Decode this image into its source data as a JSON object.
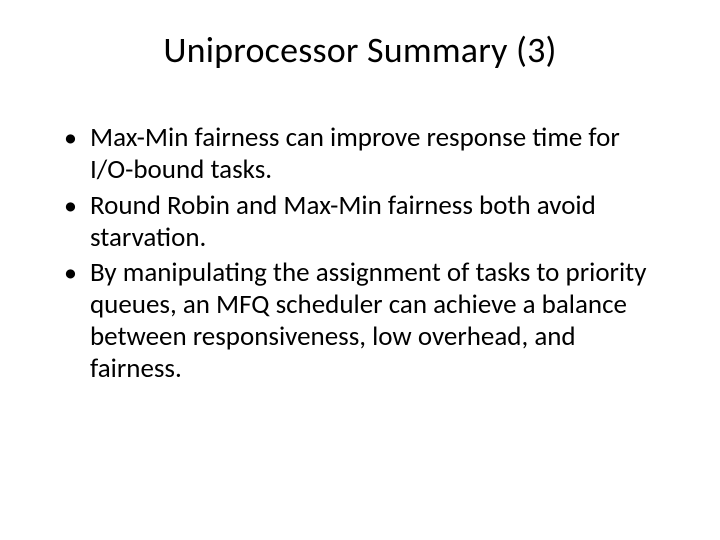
{
  "slide": {
    "title": "Uniprocessor Summary (3)",
    "bullets": [
      "Max-Min fairness can improve response time for I/O-bound tasks.",
      "Round Robin and Max-Min fairness both avoid starvation.",
      "By manipulating the assignment of tasks to priority queues, an MFQ scheduler can achieve a balance between responsiveness, low overhead, and fairness."
    ]
  }
}
